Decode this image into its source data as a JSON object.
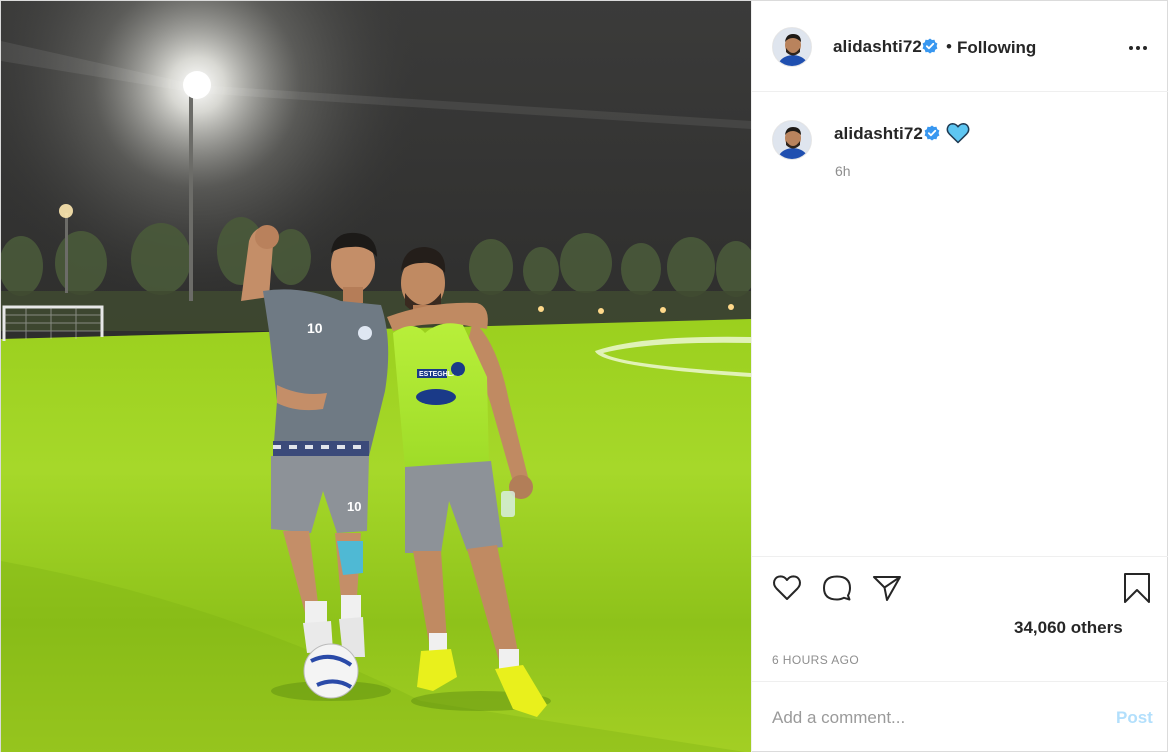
{
  "post": {
    "username": "alidashti72",
    "verified": true,
    "separator": "•",
    "follow_status": "Following",
    "more_icon": "more-horizontal-icon"
  },
  "caption": {
    "username": "alidashti72",
    "emoji": "blue-heart",
    "time": "6h"
  },
  "actions": {
    "like_icon": "heart-outline-icon",
    "comment_icon": "comment-bubble-icon",
    "share_icon": "paper-plane-icon",
    "save_icon": "bookmark-icon",
    "likes_text": "34,060 others",
    "timestamp": "6 HOURS AGO"
  },
  "comment": {
    "placeholder": "Add a comment...",
    "post_label": "Post"
  },
  "colors": {
    "verified_blue": "#3897f0",
    "post_button_disabled": "#b2dffc",
    "heart_emoji": "#5ec6f2",
    "text_primary": "#262626",
    "text_secondary": "#8e8e8e"
  }
}
